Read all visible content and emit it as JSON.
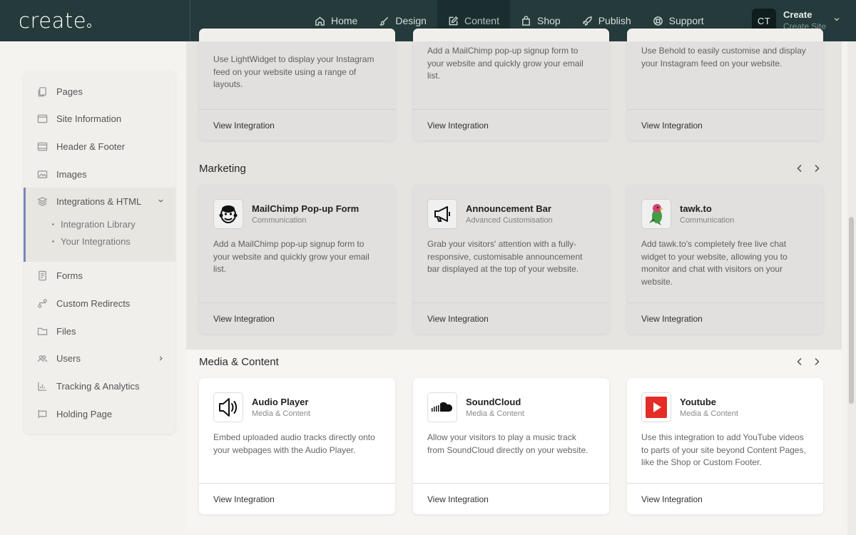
{
  "app": {
    "logo": "create"
  },
  "nav": [
    {
      "label": "Home",
      "icon": "home-icon"
    },
    {
      "label": "Design",
      "icon": "brush-icon"
    },
    {
      "label": "Content",
      "icon": "edit-icon",
      "active": true
    },
    {
      "label": "Shop",
      "icon": "bag-icon"
    },
    {
      "label": "Publish",
      "icon": "rocket-icon"
    },
    {
      "label": "Support",
      "icon": "lifebuoy-icon"
    }
  ],
  "user": {
    "initials": "CT",
    "name": "Create",
    "site": "Create Site"
  },
  "sidebar": {
    "items": [
      {
        "label": "Pages"
      },
      {
        "label": "Site Information"
      },
      {
        "label": "Header & Footer"
      },
      {
        "label": "Images"
      },
      {
        "label": "Integrations & HTML"
      },
      {
        "label": "Forms"
      },
      {
        "label": "Custom Redirects"
      },
      {
        "label": "Files"
      },
      {
        "label": "Users"
      },
      {
        "label": "Tracking & Analytics"
      },
      {
        "label": "Holding Page"
      }
    ],
    "sub_items": [
      {
        "label": "Integration Library"
      },
      {
        "label": "Your Integrations"
      }
    ]
  },
  "top_cards": [
    {
      "desc": "Use LightWidget to display your Instagram feed on your website using a range of layouts.",
      "link": "View Integration"
    },
    {
      "desc": "Add a MailChimp pop-up signup form to your website and quickly grow your email list.",
      "link": "View Integration"
    },
    {
      "desc": "Use Behold to easily customise and display your Instagram feed on your website.",
      "link": "View Integration"
    }
  ],
  "marketing": {
    "title": "Marketing",
    "cards": [
      {
        "title": "MailChimp Pop-up Form",
        "category": "Communication",
        "desc": "Add a MailChimp pop-up signup form to your website and quickly grow your email list.",
        "link": "View Integration"
      },
      {
        "title": "Announcement Bar",
        "category": "Advanced Customisation",
        "desc": "Grab your visitors' attention with a fully-responsive, customisable announcement bar displayed at the top of your website.",
        "link": "View Integration"
      },
      {
        "title": "tawk.to",
        "category": "Communication",
        "desc": "Add tawk.to's completely free live chat widget to your website, allowing you to monitor and chat with visitors on your website.",
        "link": "View Integration"
      }
    ]
  },
  "media": {
    "title": "Media & Content",
    "cards": [
      {
        "title": "Audio Player",
        "category": "Media & Content",
        "desc": "Embed uploaded audio tracks directly onto your webpages with the Audio Player.",
        "link": "View Integration"
      },
      {
        "title": "SoundCloud",
        "category": "Media & Content",
        "desc": "Allow your visitors to play a music track from SoundCloud directly on your website.",
        "link": "View Integration"
      },
      {
        "title": "Youtube",
        "category": "Media & Content",
        "desc": "Use this integration to add YouTube videos to parts of your site beyond Content Pages, like the Shop or Custom Footer.",
        "link": "View Integration"
      }
    ]
  },
  "colors": {
    "topbar": "#243a3b",
    "accent": "#7b86b8",
    "youtube": "#e52d27"
  }
}
